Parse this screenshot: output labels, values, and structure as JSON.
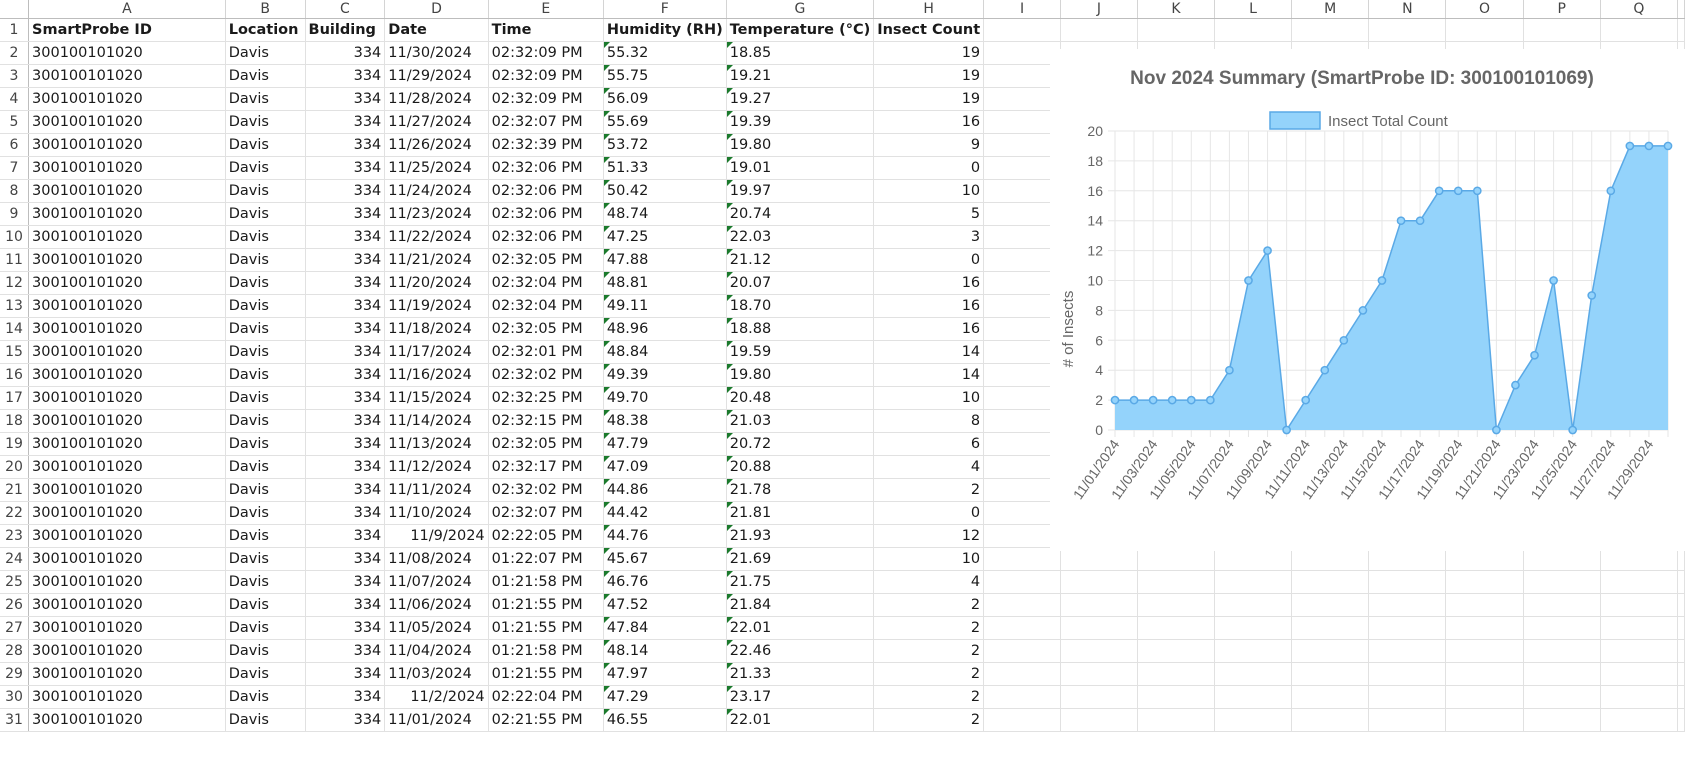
{
  "columns": [
    "A",
    "B",
    "C",
    "D",
    "E",
    "F",
    "G",
    "H",
    "I",
    "J",
    "K",
    "L",
    "M",
    "N",
    "O",
    "P",
    "Q"
  ],
  "rows": [
    [
      "SmartProbe ID",
      "Location",
      "Building",
      "Date",
      "Time",
      "Humidity (RH)",
      "Temperature (°C)",
      "Insect Count"
    ],
    [
      "300100101020",
      "Davis",
      "334",
      "11/30/2024",
      "02:32:09 PM",
      "55.32",
      "18.85",
      "19"
    ],
    [
      "300100101020",
      "Davis",
      "334",
      "11/29/2024",
      "02:32:09 PM",
      "55.75",
      "19.21",
      "19"
    ],
    [
      "300100101020",
      "Davis",
      "334",
      "11/28/2024",
      "02:32:09 PM",
      "56.09",
      "19.27",
      "19"
    ],
    [
      "300100101020",
      "Davis",
      "334",
      "11/27/2024",
      "02:32:07 PM",
      "55.69",
      "19.39",
      "16"
    ],
    [
      "300100101020",
      "Davis",
      "334",
      "11/26/2024",
      "02:32:39 PM",
      "53.72",
      "19.80",
      "9"
    ],
    [
      "300100101020",
      "Davis",
      "334",
      "11/25/2024",
      "02:32:06 PM",
      "51.33",
      "19.01",
      "0"
    ],
    [
      "300100101020",
      "Davis",
      "334",
      "11/24/2024",
      "02:32:06 PM",
      "50.42",
      "19.97",
      "10"
    ],
    [
      "300100101020",
      "Davis",
      "334",
      "11/23/2024",
      "02:32:06 PM",
      "48.74",
      "20.74",
      "5"
    ],
    [
      "300100101020",
      "Davis",
      "334",
      "11/22/2024",
      "02:32:06 PM",
      "47.25",
      "22.03",
      "3"
    ],
    [
      "300100101020",
      "Davis",
      "334",
      "11/21/2024",
      "02:32:05 PM",
      "47.88",
      "21.12",
      "0"
    ],
    [
      "300100101020",
      "Davis",
      "334",
      "11/20/2024",
      "02:32:04 PM",
      "48.81",
      "20.07",
      "16"
    ],
    [
      "300100101020",
      "Davis",
      "334",
      "11/19/2024",
      "02:32:04 PM",
      "49.11",
      "18.70",
      "16"
    ],
    [
      "300100101020",
      "Davis",
      "334",
      "11/18/2024",
      "02:32:05 PM",
      "48.96",
      "18.88",
      "16"
    ],
    [
      "300100101020",
      "Davis",
      "334",
      "11/17/2024",
      "02:32:01 PM",
      "48.84",
      "19.59",
      "14"
    ],
    [
      "300100101020",
      "Davis",
      "334",
      "11/16/2024",
      "02:32:02 PM",
      "49.39",
      "19.80",
      "14"
    ],
    [
      "300100101020",
      "Davis",
      "334",
      "11/15/2024",
      "02:32:25 PM",
      "49.70",
      "20.48",
      "10"
    ],
    [
      "300100101020",
      "Davis",
      "334",
      "11/14/2024",
      "02:32:15 PM",
      "48.38",
      "21.03",
      "8"
    ],
    [
      "300100101020",
      "Davis",
      "334",
      "11/13/2024",
      "02:32:05 PM",
      "47.79",
      "20.72",
      "6"
    ],
    [
      "300100101020",
      "Davis",
      "334",
      "11/12/2024",
      "02:32:17 PM",
      "47.09",
      "20.88",
      "4"
    ],
    [
      "300100101020",
      "Davis",
      "334",
      "11/11/2024",
      "02:32:02 PM",
      "44.86",
      "21.78",
      "2"
    ],
    [
      "300100101020",
      "Davis",
      "334",
      "11/10/2024",
      "02:32:07 PM",
      "44.42",
      "21.81",
      "0"
    ],
    [
      "300100101020",
      "Davis",
      "334",
      "11/9/2024",
      "02:22:05 PM",
      "44.76",
      "21.93",
      "12"
    ],
    [
      "300100101020",
      "Davis",
      "334",
      "11/08/2024",
      "01:22:07 PM",
      "45.67",
      "21.69",
      "10"
    ],
    [
      "300100101020",
      "Davis",
      "334",
      "11/07/2024",
      "01:21:58 PM",
      "46.76",
      "21.75",
      "4"
    ],
    [
      "300100101020",
      "Davis",
      "334",
      "11/06/2024",
      "01:21:55 PM",
      "47.52",
      "21.84",
      "2"
    ],
    [
      "300100101020",
      "Davis",
      "334",
      "11/05/2024",
      "01:21:55 PM",
      "47.84",
      "22.01",
      "2"
    ],
    [
      "300100101020",
      "Davis",
      "334",
      "11/04/2024",
      "01:21:58 PM",
      "48.14",
      "22.46",
      "2"
    ],
    [
      "300100101020",
      "Davis",
      "334",
      "11/03/2024",
      "01:21:55 PM",
      "47.97",
      "21.33",
      "2"
    ],
    [
      "300100101020",
      "Davis",
      "334",
      "11/2/2024",
      "02:22:04 PM",
      "47.29",
      "23.17",
      "2"
    ],
    [
      "300100101020",
      "Davis",
      "334",
      "11/01/2024",
      "02:21:55 PM",
      "46.55",
      "22.01",
      "2"
    ]
  ],
  "colors": {
    "series_fill": "#94d3fb",
    "series_line": "#5aa9e6",
    "flag": "#1b7a2c",
    "grid": "#e6e6e6"
  },
  "chart_data": {
    "type": "area",
    "title": "Nov 2024 Summary (SmartProbe ID: 300100101069)",
    "xlabel": "",
    "ylabel": "# of Insects",
    "ylim": [
      0,
      20
    ],
    "yticks": [
      0,
      2,
      4,
      6,
      8,
      10,
      12,
      14,
      16,
      18,
      20
    ],
    "grid": true,
    "legend_position": "top",
    "x": [
      "11/01/2024",
      "11/02/2024",
      "11/03/2024",
      "11/04/2024",
      "11/05/2024",
      "11/06/2024",
      "11/07/2024",
      "11/08/2024",
      "11/09/2024",
      "11/10/2024",
      "11/11/2024",
      "11/12/2024",
      "11/13/2024",
      "11/14/2024",
      "11/15/2024",
      "11/16/2024",
      "11/17/2024",
      "11/18/2024",
      "11/19/2024",
      "11/20/2024",
      "11/21/2024",
      "11/22/2024",
      "11/23/2024",
      "11/24/2024",
      "11/25/2024",
      "11/26/2024",
      "11/27/2024",
      "11/28/2024",
      "11/29/2024",
      "11/30/2024"
    ],
    "x_tick_labels": [
      "11/01/2024",
      "11/03/2024",
      "11/05/2024",
      "11/07/2024",
      "11/09/2024",
      "11/11/2024",
      "11/13/2024",
      "11/15/2024",
      "11/17/2024",
      "11/19/2024",
      "11/21/2024",
      "11/23/2024",
      "11/25/2024",
      "11/27/2024",
      "11/29/2024"
    ],
    "series": [
      {
        "name": "Insect Total Count",
        "values": [
          2,
          2,
          2,
          2,
          2,
          2,
          4,
          10,
          12,
          0,
          2,
          4,
          6,
          8,
          10,
          14,
          14,
          16,
          16,
          16,
          0,
          3,
          5,
          10,
          0,
          9,
          16,
          19,
          19,
          19
        ]
      }
    ]
  }
}
